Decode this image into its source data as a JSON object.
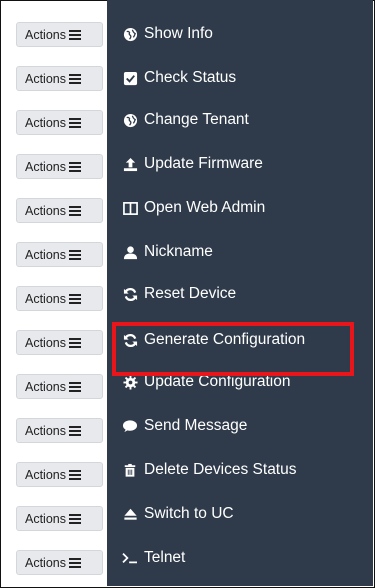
{
  "actions_label": "Actions",
  "menu": {
    "items": [
      {
        "label": "Show Info",
        "icon": "globe-icon"
      },
      {
        "label": "Check Status",
        "icon": "check-square-icon"
      },
      {
        "label": "Change Tenant",
        "icon": "globe-icon"
      },
      {
        "label": "Update Firmware",
        "icon": "upload-icon"
      },
      {
        "label": "Open Web Admin",
        "icon": "columns-icon"
      },
      {
        "label": "Nickname",
        "icon": "user-icon"
      },
      {
        "label": "Reset Device",
        "icon": "refresh-icon"
      },
      {
        "label": "Generate Configuration",
        "icon": "refresh-icon"
      },
      {
        "label": "Update Configuration",
        "icon": "gear-icon"
      },
      {
        "label": "Send Message",
        "icon": "comment-icon"
      },
      {
        "label": "Delete Devices Status",
        "icon": "trash-icon"
      },
      {
        "label": "Switch to UC",
        "icon": "eject-icon"
      },
      {
        "label": "Telnet",
        "icon": "terminal-icon"
      }
    ],
    "highlighted_item": "Generate Configuration"
  },
  "colors": {
    "menu_background": "#2f3b4a",
    "menu_text": "#ffffff",
    "highlight_border": "#e8151b",
    "button_background": "#e7e9ec"
  }
}
